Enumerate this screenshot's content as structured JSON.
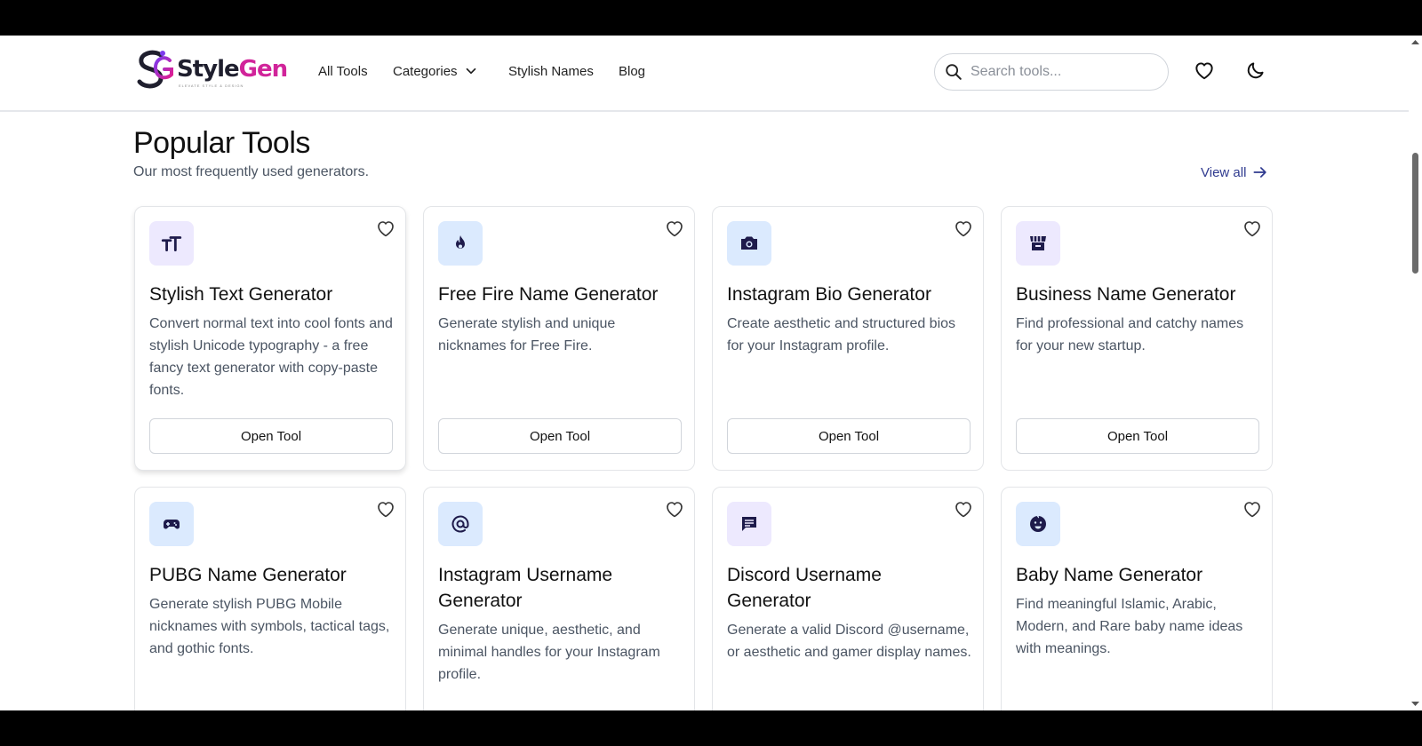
{
  "brand": {
    "part1": "Style",
    "part2": "Gen",
    "tagline": "ELEVATE STYLE & DESIGN"
  },
  "nav": [
    {
      "label": "All Tools"
    },
    {
      "label": "Categories"
    },
    {
      "label": "Stylish Names"
    },
    {
      "label": "Blog"
    }
  ],
  "search": {
    "placeholder": "Search tools...",
    "value": ""
  },
  "section": {
    "title": "Popular Tools",
    "subtitle": "Our most frequently used generators.",
    "view_all": "View all"
  },
  "tools": [
    {
      "icon": "text-size-icon",
      "title": "Stylish Text Generator",
      "description": "Convert normal text into cool fonts and stylish Unicode typography - a free fancy text generator with copy-paste fonts.",
      "button": "Open Tool"
    },
    {
      "icon": "fire-icon",
      "title": "Free Fire Name Generator",
      "description": "Generate stylish and unique nicknames for Free Fire.",
      "button": "Open Tool"
    },
    {
      "icon": "camera-icon",
      "title": "Instagram Bio Generator",
      "description": "Create aesthetic and structured bios for your Instagram profile.",
      "button": "Open Tool"
    },
    {
      "icon": "store-icon",
      "title": "Business Name Generator",
      "description": "Find professional and catchy names for your new startup.",
      "button": "Open Tool"
    },
    {
      "icon": "gamepad-icon",
      "title": "PUBG Name Generator",
      "description": "Generate stylish PUBG Mobile nicknames with symbols, tactical tags, and gothic fonts."
    },
    {
      "icon": "at-sign-icon",
      "title": "Instagram Username Generator",
      "description": "Generate unique, aesthetic, and minimal handles for your Instagram profile."
    },
    {
      "icon": "chat-icon",
      "title": "Discord Username Generator",
      "description": "Generate a valid Discord @username, or aesthetic and gamer display names."
    },
    {
      "icon": "baby-face-icon",
      "title": "Baby Name Generator",
      "description": "Find meaningful Islamic, Arabic, Modern, and Rare baby name ideas with meanings."
    }
  ],
  "colors": {
    "accent": "#2f3a8f",
    "brand_pink": "#d1249a",
    "icon_purple_bg": "#ede9fe",
    "icon_blue_bg": "#dbeafe"
  }
}
